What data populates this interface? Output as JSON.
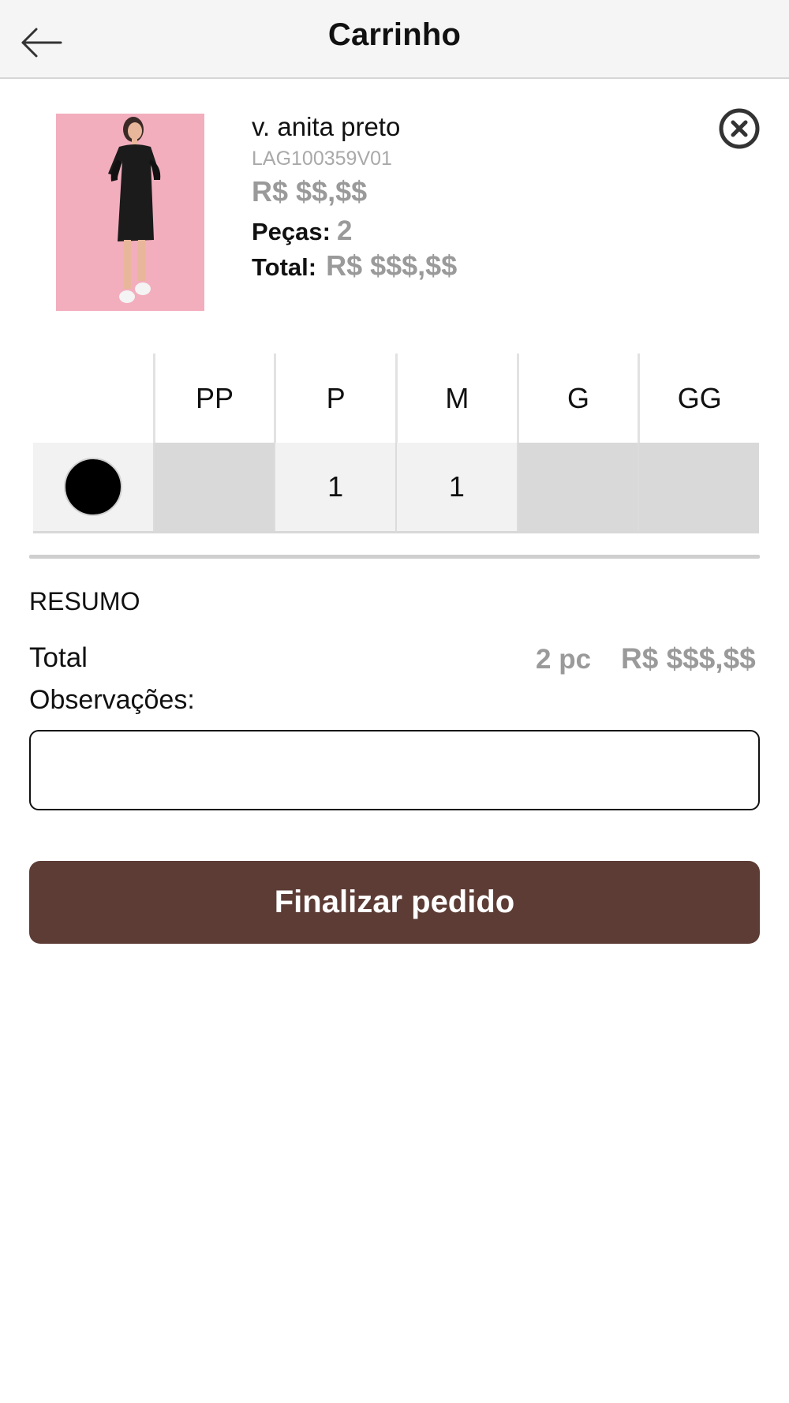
{
  "header": {
    "title": "Carrinho"
  },
  "product": {
    "name": "v. anita preto",
    "sku": "LAG100359V01",
    "price": "R$ $$,$$",
    "pieces_label": "Peças:",
    "pieces_value": "2",
    "total_label": "Total:",
    "total_value": "R$ $$$,$$"
  },
  "grid": {
    "sizes": [
      "PP",
      "P",
      "M",
      "G",
      "GG"
    ],
    "rows": [
      {
        "color": "#000000",
        "quantities": [
          "",
          "1",
          "1",
          "",
          ""
        ]
      }
    ]
  },
  "summary": {
    "title": "RESUMO",
    "total_label": "Total",
    "count": "2 pc",
    "amount": "R$ $$$,$$",
    "notes_label": "Observações:",
    "notes_value": ""
  },
  "actions": {
    "finalize_label": "Finalizar pedido"
  },
  "colors": {
    "accent": "#5d3c35",
    "muted": "#9a9a9a",
    "image_bg": "#f2aebd"
  },
  "icons": {
    "back": "arrow-left-icon",
    "remove": "close-circle-icon"
  }
}
